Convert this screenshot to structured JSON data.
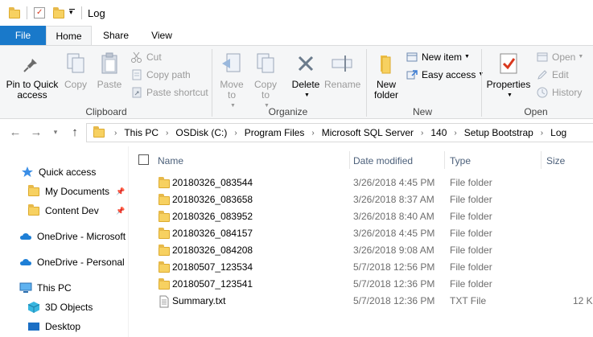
{
  "window": {
    "title": "Log"
  },
  "tabs": [
    {
      "label": "File"
    },
    {
      "label": "Home"
    },
    {
      "label": "Share"
    },
    {
      "label": "View"
    }
  ],
  "ribbon": {
    "clipboard": {
      "label": "Clipboard",
      "pin_label": "Pin to Quick access",
      "copy_label": "Copy",
      "paste_label": "Paste",
      "cut_label": "Cut",
      "copy_path_label": "Copy path",
      "paste_shortcut_label": "Paste shortcut"
    },
    "organize": {
      "label": "Organize",
      "move_to_label": "Move to",
      "copy_to_label": "Copy to",
      "delete_label": "Delete",
      "rename_label": "Rename"
    },
    "new": {
      "label": "New",
      "new_folder_label": "New folder",
      "new_item_label": "New item",
      "easy_access_label": "Easy access"
    },
    "open": {
      "label": "Open",
      "properties_label": "Properties",
      "open_label": "Open",
      "edit_label": "Edit",
      "history_label": "History"
    }
  },
  "breadcrumb": [
    "This PC",
    "OSDisk (C:)",
    "Program Files",
    "Microsoft SQL Server",
    "140",
    "Setup Bootstrap",
    "Log"
  ],
  "nav_pane": [
    {
      "label": "Quick access",
      "icon": "star-icon"
    },
    {
      "label": "My Documents",
      "icon": "folder-icon",
      "pinned": true
    },
    {
      "label": "Content Dev",
      "icon": "folder-icon",
      "pinned": true
    },
    {
      "label": "OneDrive - Microsoft",
      "icon": "cloud-icon"
    },
    {
      "label": "OneDrive - Personal",
      "icon": "cloud-icon"
    },
    {
      "label": "This PC",
      "icon": "computer-icon"
    },
    {
      "label": "3D Objects",
      "icon": "cube-icon"
    },
    {
      "label": "Desktop",
      "icon": "desktop-icon"
    }
  ],
  "columns": {
    "name": "Name",
    "date": "Date modified",
    "type": "Type",
    "size": "Size"
  },
  "files": [
    {
      "name": "20180326_083544",
      "date": "3/26/2018 4:45 PM",
      "type": "File folder",
      "size": "",
      "icon": "folder-icon"
    },
    {
      "name": "20180326_083658",
      "date": "3/26/2018 8:37 AM",
      "type": "File folder",
      "size": "",
      "icon": "folder-icon"
    },
    {
      "name": "20180326_083952",
      "date": "3/26/2018 8:40 AM",
      "type": "File folder",
      "size": "",
      "icon": "folder-icon"
    },
    {
      "name": "20180326_084157",
      "date": "3/26/2018 4:45 PM",
      "type": "File folder",
      "size": "",
      "icon": "folder-icon"
    },
    {
      "name": "20180326_084208",
      "date": "3/26/2018 9:08 AM",
      "type": "File folder",
      "size": "",
      "icon": "folder-icon"
    },
    {
      "name": "20180507_123534",
      "date": "5/7/2018 12:56 PM",
      "type": "File folder",
      "size": "",
      "icon": "folder-icon"
    },
    {
      "name": "20180507_123541",
      "date": "5/7/2018 12:36 PM",
      "type": "File folder",
      "size": "",
      "icon": "folder-icon"
    },
    {
      "name": "Summary.txt",
      "date": "5/7/2018 12:36 PM",
      "type": "TXT File",
      "size": "12 K",
      "icon": "text-file-icon"
    }
  ],
  "colors": {
    "file_tab": "#1979ca",
    "ribbon_bg": "#f5f6f7",
    "header_text": "#4c607a",
    "folder": "#f7d161",
    "accent_blue": "#1e90ff"
  }
}
